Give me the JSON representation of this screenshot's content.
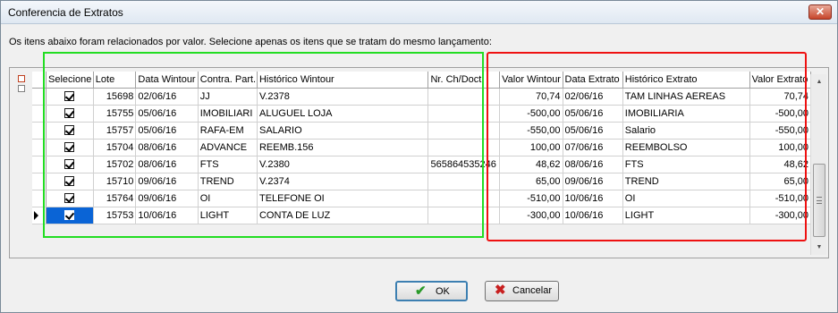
{
  "window": {
    "title": "Conferencia de Extratos",
    "close_label": "✕"
  },
  "instruction": "Os itens abaixo foram relacionados por valor. Selecione apenas os itens que se tratam do mesmo lançamento:",
  "grid": {
    "columns": [
      "Selecione",
      "Lote",
      "Data Wintour",
      "Contra. Part.",
      "Histórico Wintour",
      "Nr. Ch/Doct",
      "Valor Wintour",
      "Data Extrato",
      "Histórico Extrato",
      "Valor Extrato"
    ],
    "rows": [
      {
        "selecione": true,
        "lote": "15698",
        "data_wintour": "02/06/16",
        "contra_part": "JJ",
        "historico_wintour": "V.2378",
        "nr_ch_doct": "",
        "valor_wintour": "70,74",
        "data_extrato": "02/06/16",
        "historico_extrato": "TAM LINHAS AEREAS",
        "valor_extrato": "70,74"
      },
      {
        "selecione": true,
        "lote": "15755",
        "data_wintour": "05/06/16",
        "contra_part": "IMOBILIARI",
        "historico_wintour": "ALUGUEL LOJA",
        "nr_ch_doct": "",
        "valor_wintour": "-500,00",
        "data_extrato": "05/06/16",
        "historico_extrato": "IMOBILIARIA",
        "valor_extrato": "-500,00"
      },
      {
        "selecione": true,
        "lote": "15757",
        "data_wintour": "05/06/16",
        "contra_part": "RAFA-EM",
        "historico_wintour": "SALARIO",
        "nr_ch_doct": "",
        "valor_wintour": "-550,00",
        "data_extrato": "05/06/16",
        "historico_extrato": "Salario",
        "valor_extrato": "-550,00"
      },
      {
        "selecione": true,
        "lote": "15704",
        "data_wintour": "08/06/16",
        "contra_part": "ADVANCE",
        "historico_wintour": "REEMB.156",
        "nr_ch_doct": "",
        "valor_wintour": "100,00",
        "data_extrato": "07/06/16",
        "historico_extrato": "REEMBOLSO",
        "valor_extrato": "100,00"
      },
      {
        "selecione": true,
        "lote": "15702",
        "data_wintour": "08/06/16",
        "contra_part": "FTS",
        "historico_wintour": "V.2380",
        "nr_ch_doct": "565864535246",
        "valor_wintour": "48,62",
        "data_extrato": "08/06/16",
        "historico_extrato": "FTS",
        "valor_extrato": "48,62"
      },
      {
        "selecione": true,
        "lote": "15710",
        "data_wintour": "09/06/16",
        "contra_part": "TREND",
        "historico_wintour": "V.2374",
        "nr_ch_doct": "",
        "valor_wintour": "65,00",
        "data_extrato": "09/06/16",
        "historico_extrato": "TREND",
        "valor_extrato": "65,00"
      },
      {
        "selecione": true,
        "lote": "15764",
        "data_wintour": "09/06/16",
        "contra_part": "OI",
        "historico_wintour": "TELEFONE OI",
        "nr_ch_doct": "",
        "valor_wintour": "-510,00",
        "data_extrato": "10/06/16",
        "historico_extrato": "OI",
        "valor_extrato": "-510,00"
      },
      {
        "selecione": true,
        "lote": "15753",
        "data_wintour": "10/06/16",
        "contra_part": "LIGHT",
        "historico_wintour": "CONTA DE LUZ",
        "nr_ch_doct": "",
        "valor_wintour": "-300,00",
        "data_extrato": "10/06/16",
        "historico_extrato": "LIGHT",
        "valor_extrato": "-300,00"
      }
    ],
    "current_row": 7
  },
  "buttons": {
    "ok_label": "OK",
    "cancel_label": "Cancelar"
  },
  "icons": {
    "ok": "check-icon",
    "cancel": "x-icon"
  },
  "colors": {
    "highlight_left": "#22dd22",
    "highlight_right": "#ee1111",
    "selection": "#0a64d6"
  }
}
